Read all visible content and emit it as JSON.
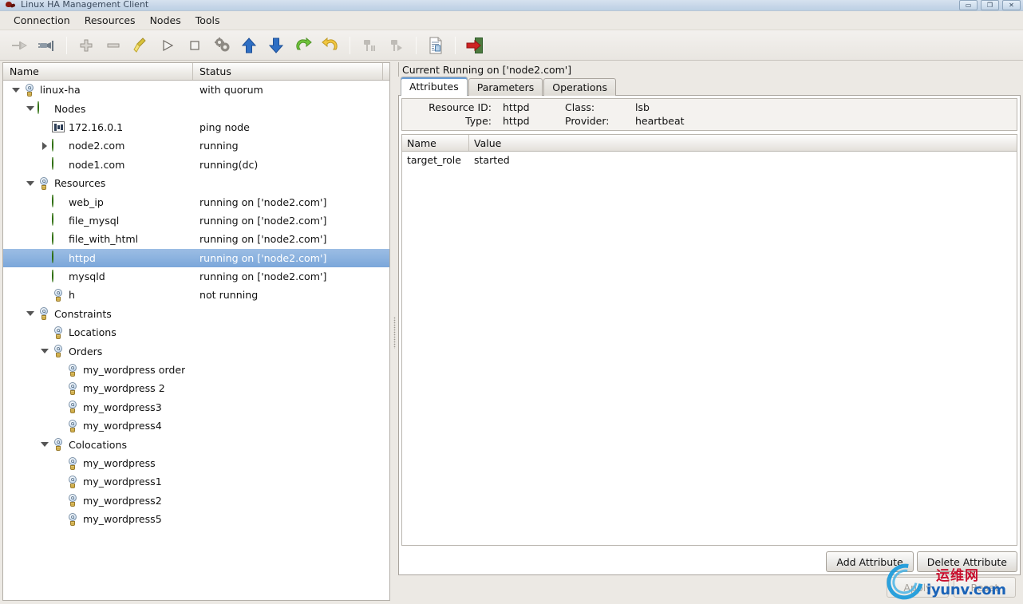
{
  "window": {
    "title": "Linux HA Management Client",
    "app_icon": "ladybug-icon",
    "controls": [
      {
        "name": "minimize-button",
        "glyph": "▭"
      },
      {
        "name": "maximize-button",
        "glyph": "❐"
      },
      {
        "name": "close-button",
        "glyph": "✕"
      }
    ]
  },
  "menubar": {
    "items": [
      {
        "label": "Connection"
      },
      {
        "label": "Resources"
      },
      {
        "label": "Nodes"
      },
      {
        "label": "Tools"
      }
    ]
  },
  "toolbar": {
    "items": [
      {
        "name": "disconnect-icon",
        "tooltip": "Disconnect",
        "disabled": true
      },
      {
        "name": "connect-icon",
        "tooltip": "Connect",
        "disabled": false
      },
      {
        "name": "separator-1",
        "type": "separator"
      },
      {
        "name": "add-icon",
        "tooltip": "Add",
        "disabled": false
      },
      {
        "name": "remove-icon",
        "tooltip": "Remove",
        "disabled": false
      },
      {
        "name": "cleanup-broom-icon",
        "tooltip": "Cleanup",
        "disabled": false
      },
      {
        "name": "start-icon",
        "tooltip": "Start",
        "disabled": false
      },
      {
        "name": "stop-icon",
        "tooltip": "Stop",
        "disabled": false
      },
      {
        "name": "manage-gears-icon",
        "tooltip": "Manage",
        "disabled": false
      },
      {
        "name": "move-up-icon",
        "tooltip": "Move Up",
        "disabled": false
      },
      {
        "name": "move-down-icon",
        "tooltip": "Move Down",
        "disabled": false
      },
      {
        "name": "migrate-icon",
        "tooltip": "Migrate",
        "disabled": false
      },
      {
        "name": "unmigrate-icon",
        "tooltip": "Unmigrate",
        "disabled": false
      },
      {
        "name": "separator-2",
        "type": "separator"
      },
      {
        "name": "standby-icon",
        "tooltip": "Standby",
        "disabled": true
      },
      {
        "name": "active-icon",
        "tooltip": "Active",
        "disabled": true
      },
      {
        "name": "separator-3",
        "type": "separator"
      },
      {
        "name": "cib-document-icon",
        "tooltip": "CIB",
        "disabled": false
      },
      {
        "name": "separator-4",
        "type": "separator"
      },
      {
        "name": "quit-exit-icon",
        "tooltip": "Quit",
        "disabled": false
      }
    ]
  },
  "tree": {
    "columns": [
      "Name",
      "Status"
    ],
    "rows": [
      {
        "indent": 0,
        "twist": "open",
        "icon": "bulb",
        "name": "linux-ha",
        "status": "with quorum",
        "selected": false
      },
      {
        "indent": 1,
        "twist": "open",
        "icon": "ball",
        "name": "Nodes",
        "status": "",
        "selected": false
      },
      {
        "indent": 2,
        "twist": "none",
        "icon": "grid",
        "name": "172.16.0.1",
        "status": "ping node",
        "selected": false
      },
      {
        "indent": 2,
        "twist": "closed",
        "icon": "ball",
        "name": "node2.com",
        "status": "running",
        "selected": false
      },
      {
        "indent": 2,
        "twist": "none",
        "icon": "ball",
        "name": "node1.com",
        "status": "running(dc)",
        "selected": false
      },
      {
        "indent": 1,
        "twist": "open",
        "icon": "bulb",
        "name": "Resources",
        "status": "",
        "selected": false
      },
      {
        "indent": 2,
        "twist": "none",
        "icon": "ball",
        "name": "web_ip",
        "status": "running on ['node2.com']",
        "selected": false
      },
      {
        "indent": 2,
        "twist": "none",
        "icon": "ball",
        "name": "file_mysql",
        "status": "running on ['node2.com']",
        "selected": false
      },
      {
        "indent": 2,
        "twist": "none",
        "icon": "ball",
        "name": "file_with_html",
        "status": "running on ['node2.com']",
        "selected": false
      },
      {
        "indent": 2,
        "twist": "none",
        "icon": "ball",
        "name": "httpd",
        "status": "running on ['node2.com']",
        "selected": true
      },
      {
        "indent": 2,
        "twist": "none",
        "icon": "ball",
        "name": "mysqld",
        "status": "running on ['node2.com']",
        "selected": false
      },
      {
        "indent": 2,
        "twist": "none",
        "icon": "bulb",
        "name": "h",
        "status": "not running",
        "selected": false
      },
      {
        "indent": 1,
        "twist": "open",
        "icon": "bulb",
        "name": "Constraints",
        "status": "",
        "selected": false
      },
      {
        "indent": 2,
        "twist": "none",
        "icon": "bulb",
        "name": "Locations",
        "status": "",
        "selected": false
      },
      {
        "indent": 2,
        "twist": "open",
        "icon": "bulb",
        "name": "Orders",
        "status": "",
        "selected": false
      },
      {
        "indent": 3,
        "twist": "none",
        "icon": "bulb",
        "name": "my_wordpress order",
        "status": "",
        "selected": false
      },
      {
        "indent": 3,
        "twist": "none",
        "icon": "bulb",
        "name": "my_wordpress 2",
        "status": "",
        "selected": false
      },
      {
        "indent": 3,
        "twist": "none",
        "icon": "bulb",
        "name": "my_wordpress3",
        "status": "",
        "selected": false
      },
      {
        "indent": 3,
        "twist": "none",
        "icon": "bulb",
        "name": "my_wordpress4",
        "status": "",
        "selected": false
      },
      {
        "indent": 2,
        "twist": "open",
        "icon": "bulb",
        "name": "Colocations",
        "status": "",
        "selected": false
      },
      {
        "indent": 3,
        "twist": "none",
        "icon": "bulb",
        "name": "my_wordpress",
        "status": "",
        "selected": false
      },
      {
        "indent": 3,
        "twist": "none",
        "icon": "bulb",
        "name": "my_wordpress1",
        "status": "",
        "selected": false
      },
      {
        "indent": 3,
        "twist": "none",
        "icon": "bulb",
        "name": "my_wordpress2",
        "status": "",
        "selected": false
      },
      {
        "indent": 3,
        "twist": "none",
        "icon": "bulb",
        "name": "my_wordpress5",
        "status": "",
        "selected": false
      }
    ]
  },
  "detail": {
    "header": "Current Running on ['node2.com']",
    "tabs": [
      {
        "label": "Attributes",
        "active": true
      },
      {
        "label": "Parameters",
        "active": false
      },
      {
        "label": "Operations",
        "active": false
      }
    ],
    "info": {
      "resource_id_label": "Resource ID:",
      "resource_id_value": "httpd",
      "class_label": "Class:",
      "class_value": "lsb",
      "type_label": "Type:",
      "type_value": "httpd",
      "provider_label": "Provider:",
      "provider_value": "heartbeat"
    },
    "attributes_table": {
      "columns": [
        "Name",
        "Value"
      ],
      "rows": [
        {
          "name": "target_role",
          "value": "started"
        }
      ]
    },
    "buttons": {
      "add_attribute": "Add Attribute",
      "delete_attribute": "Delete Attribute",
      "apply": "Apply",
      "reset": "Reset"
    }
  },
  "watermark": {
    "cn": "运维网",
    "en": "iyunv.com"
  },
  "colors": {
    "selection": "#7ba7da",
    "node_green": "#6cc22c",
    "tab_accent": "#6a9fd8",
    "watermark_blue": "#1a63b8",
    "watermark_red": "#c8102e"
  }
}
